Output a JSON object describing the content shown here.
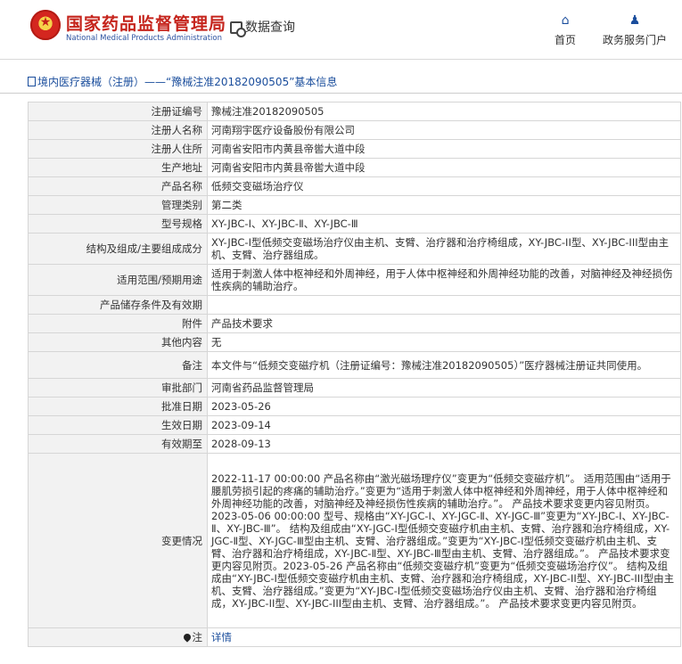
{
  "header": {
    "site_name_cn": "国家药品监督管理局",
    "site_name_en": "National Medical Products Administration",
    "data_query": "数据查询",
    "nav_home": "首页",
    "nav_portal": "政务服务门户"
  },
  "breadcrumb": "境内医疗器械（注册）——“豫械注准20182090505”基本信息",
  "rows": [
    {
      "label": "注册证编号",
      "value": "豫械注准20182090505"
    },
    {
      "label": "注册人名称",
      "value": "河南翔宇医疗设备股份有限公司"
    },
    {
      "label": "注册人住所",
      "value": "河南省安阳市内黄县帝喾大道中段"
    },
    {
      "label": "生产地址",
      "value": "河南省安阳市内黄县帝喾大道中段"
    },
    {
      "label": "产品名称",
      "value": "低频交变磁场治疗仪"
    },
    {
      "label": "管理类别",
      "value": "第二类"
    },
    {
      "label": "型号规格",
      "value": "XY-JBC-Ⅰ、XY-JBC-Ⅱ、XY-JBC-Ⅲ"
    },
    {
      "label": "结构及组成/主要组成成分",
      "value": "XY-JBC-I型低频交变磁场治疗仪由主机、支臂、治疗器和治疗椅组成，XY-JBC-II型、XY-JBC-III型由主机、支臂、治疗器组成。"
    },
    {
      "label": "适用范围/预期用途",
      "value": "适用于刺激人体中枢神经和外周神经，用于人体中枢神经和外周神经功能的改善，对脑神经及神经损伤性疾病的辅助治疗。"
    },
    {
      "label": "产品储存条件及有效期",
      "value": ""
    },
    {
      "label": "附件",
      "value": "产品技术要求"
    },
    {
      "label": "其他内容",
      "value": "无"
    },
    {
      "label": "备注",
      "value": "本文件与“低频交变磁疗机（注册证编号：豫械注准20182090505）”医疗器械注册证共同使用。"
    },
    {
      "label": "审批部门",
      "value": "河南省药品监督管理局"
    },
    {
      "label": "批准日期",
      "value": "2023-05-26"
    },
    {
      "label": "生效日期",
      "value": "2023-09-14"
    },
    {
      "label": "有效期至",
      "value": "2028-09-13"
    },
    {
      "label": "变更情况",
      "value": "2022-11-17 00:00:00 产品名称由“激光磁场理疗仪”变更为“低频交变磁疗机”。 适用范围由“适用于腰肌劳损引起的疼痛的辅助治疗。”变更为“适用于刺激人体中枢神经和外周神经，用于人体中枢神经和外周神经功能的改善，对脑神经及神经损伤性疾病的辅助治疗。”。 产品技术要求变更内容见附页。\n2023-05-06 00:00:00 型号、规格由“XY-JGC-Ⅰ、XY-JGC-Ⅱ、XY-JGC-Ⅲ”变更为“XY-JBC-Ⅰ、XY-JBC-Ⅱ、XY-JBC-Ⅲ”。 结构及组成由“XY-JGC-Ⅰ型低频交变磁疗机由主机、支臂、治疗器和治疗椅组成，XY-JGC-Ⅱ型、XY-JGC-Ⅲ型由主机、支臂、治疗器组成。”变更为“XY-JBC-Ⅰ型低频交变磁疗机由主机、支臂、治疗器和治疗椅组成，XY-JBC-Ⅱ型、XY-JBC-Ⅲ型由主机、支臂、治疗器组成。”。 产品技术要求变更内容见附页。2023-05-26 产品名称由“低频交变磁疗机”变更为“低频交变磁场治疗仪”。 结构及组成由“XY-JBC-I型低频交变磁疗机由主机、支臂、治疗器和治疗椅组成，XY-JBC-II型、XY-JBC-III型由主机、支臂、治疗器组成。”变更为“XY-JBC-I型低频交变磁场治疗仪由主机、支臂、治疗器和治疗椅组成，XY-JBC-II型、XY-JBC-III型由主机、支臂、治疗器组成。”。 产品技术要求变更内容见附页。"
    }
  ],
  "note": {
    "label": "注",
    "link": "详情"
  },
  "colors": {
    "brand_red": "#c5241c",
    "link_blue": "#1a4d9c",
    "label_bg": "#f2f2f2",
    "border": "#d6d6d6"
  },
  "icons": [
    "emblem-logo",
    "data-query-icon",
    "home-icon",
    "user-icon",
    "document-icon",
    "pin-icon"
  ]
}
